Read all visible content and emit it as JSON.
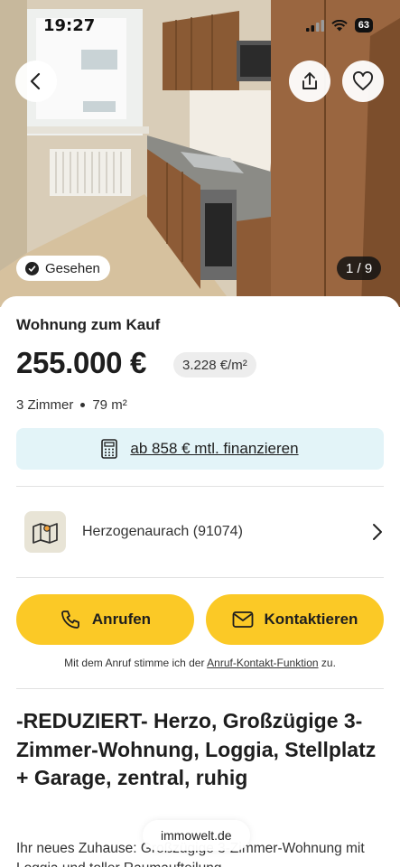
{
  "status_bar": {
    "time": "19:27",
    "battery": "63"
  },
  "gallery": {
    "seen_label": "Gesehen",
    "counter": "1 / 9"
  },
  "listing": {
    "type": "Wohnung zum Kauf",
    "price": "255.000 €",
    "price_per_sqm": "3.228 €/m²",
    "rooms": "3 Zimmer",
    "area": "79 m²"
  },
  "financing": {
    "label": "ab 858 € mtl. finanzieren"
  },
  "location": {
    "label": "Herzogenaurach (91074)"
  },
  "actions": {
    "call_label": "Anrufen",
    "contact_label": "Kontaktieren"
  },
  "consent": {
    "prefix": "Mit dem Anruf stimme ich der ",
    "link": "Anruf-Kontakt-Funktion",
    "suffix": " zu."
  },
  "headline": "-REDUZIERT- Herzo, Großzügige 3-Zimmer-Wohnung, Loggia, Stellplatz + Garage, zentral, ruhig",
  "description": "Ihr neues Zuhause: Großzügige 3-Zimmer-Wohnung mit Loggia und toller Raumaufteilung",
  "browser": {
    "url": "immowelt.de"
  },
  "colors": {
    "accent": "#fbc926",
    "finance_bg": "#e3f4f8"
  },
  "icons": [
    "back-arrow-icon",
    "share-icon",
    "heart-icon",
    "check-icon",
    "calculator-icon",
    "map-icon",
    "chevron-right-icon",
    "phone-icon",
    "mail-icon"
  ]
}
